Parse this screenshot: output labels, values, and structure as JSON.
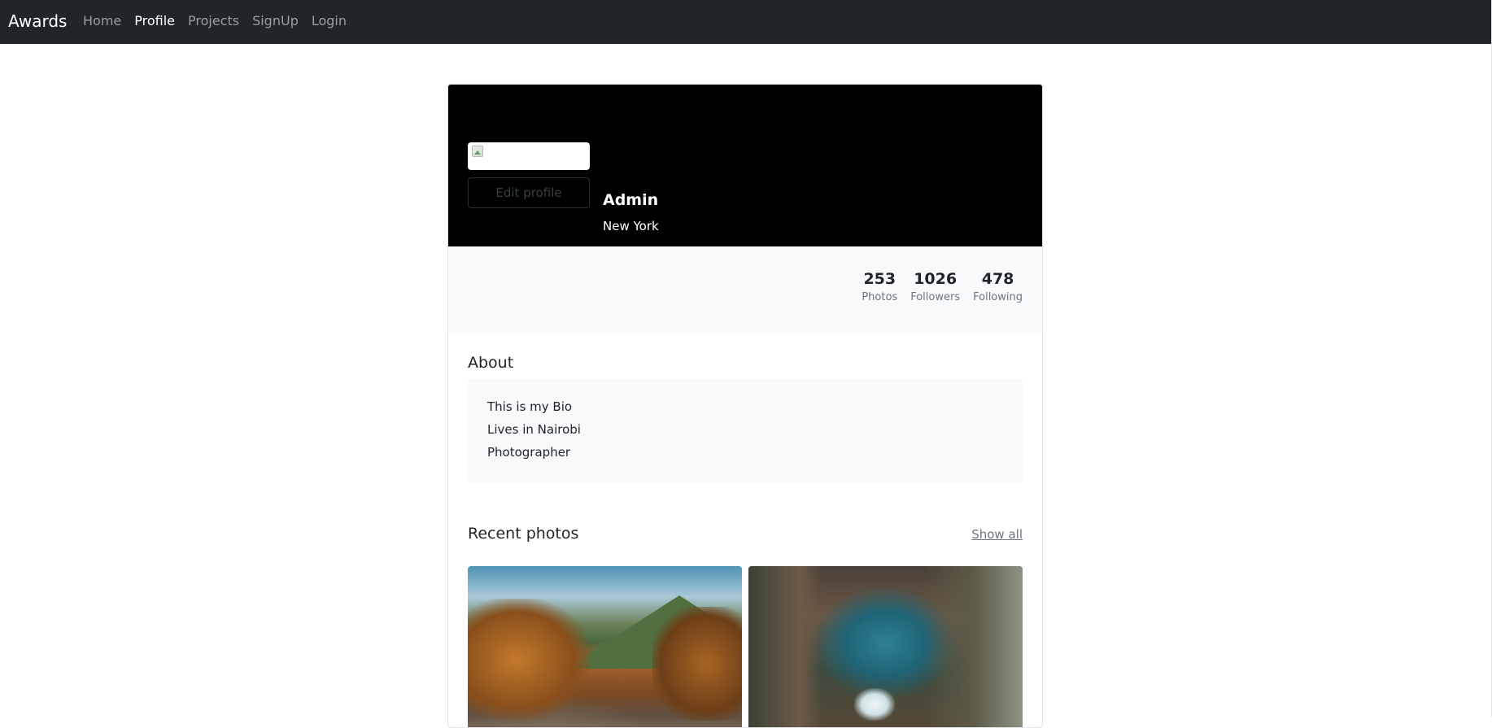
{
  "navbar": {
    "brand": "Awards",
    "links": [
      {
        "label": "Home",
        "active": false
      },
      {
        "label": "Profile",
        "active": true
      },
      {
        "label": "Projects",
        "active": false
      },
      {
        "label": "SignUp",
        "active": false
      },
      {
        "label": "Login",
        "active": false
      }
    ]
  },
  "profile": {
    "edit_button": "Edit profile",
    "name": "Admin",
    "location": "New York",
    "stats": [
      {
        "value": "253",
        "label": "Photos"
      },
      {
        "value": "1026",
        "label": "Followers"
      },
      {
        "value": "478",
        "label": "Following"
      }
    ]
  },
  "about": {
    "heading": "About",
    "lines": [
      "This is my Bio",
      "Lives in Nairobi",
      "Photographer"
    ]
  },
  "recent_photos": {
    "heading": "Recent photos",
    "show_all": "Show all"
  },
  "colors": {
    "navbar_bg": "#212529",
    "cover_bg": "#000000",
    "panel_bg": "#f8f9fa",
    "muted_text": "#6c757d"
  }
}
